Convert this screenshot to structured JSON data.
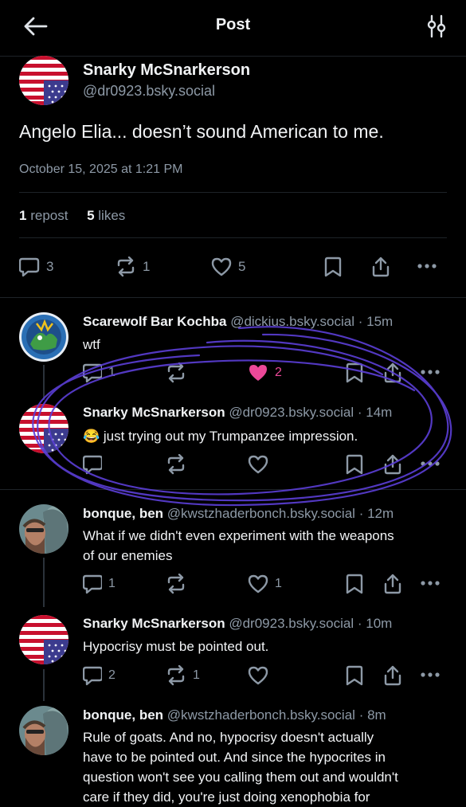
{
  "header": {
    "title": "Post",
    "back_icon": "arrow-left-icon",
    "filter_icon": "sliders-icon"
  },
  "main_post": {
    "author": "Snarky McSnarkerson",
    "handle": "@dr0923.bsky.social",
    "text": "Angelo Elia... doesn’t sound American to me.",
    "date": "October 15, 2025 at 1:21 PM",
    "reposts_count": "1",
    "reposts_label": "repost",
    "likes_count": "5",
    "likes_label": "likes",
    "reply_count": "3",
    "repost_count": "1",
    "like_count": "5"
  },
  "replies": [
    {
      "author": "Scarewolf Bar Kochba",
      "handle": "@dickius.bsky.social",
      "time": "· 15m",
      "text": "wtf",
      "reply_count": "1",
      "repost_count": "",
      "like_count": "2",
      "liked": true
    },
    {
      "author": "Snarky McSnarkerson",
      "handle": "@dr0923.bsky.social",
      "time": "· 14m",
      "text": "😂 just trying out my Trumpanzee impression.",
      "reply_count": "",
      "repost_count": "",
      "like_count": "",
      "liked": false
    },
    {
      "author": "bonque, ben",
      "handle": "@kwstzhaderbonch.bsky.social",
      "time": "· 12m",
      "text_line1": "What if we didn't even experiment with the weapons",
      "text_line2": "of our enemies",
      "reply_count": "1",
      "repost_count": "",
      "like_count": "1",
      "liked": false
    },
    {
      "author": "Snarky McSnarkerson",
      "handle": "@dr0923.bsky.social",
      "time": "· 10m",
      "text": "Hypocrisy must be pointed out.",
      "reply_count": "2",
      "repost_count": "1",
      "like_count": "",
      "liked": false
    },
    {
      "author": "bonque, ben",
      "handle": "@kwstzhaderbonch.bsky.social",
      "time": "· 8m",
      "text_line1": "Rule of goats. And no, hypocrisy doesn't actually",
      "text_line2": "have to be pointed out. And since the hypocrites in",
      "text_line3": "question won't see you calling them out and wouldn't",
      "text_line4": "care if they did, you're just doing xenophobia for"
    }
  ],
  "colors": {
    "background": "#000000",
    "text": "#f1f3f5",
    "muted": "#8d99a6",
    "like": "#ec4899",
    "scribble": "#5b3fd6"
  }
}
